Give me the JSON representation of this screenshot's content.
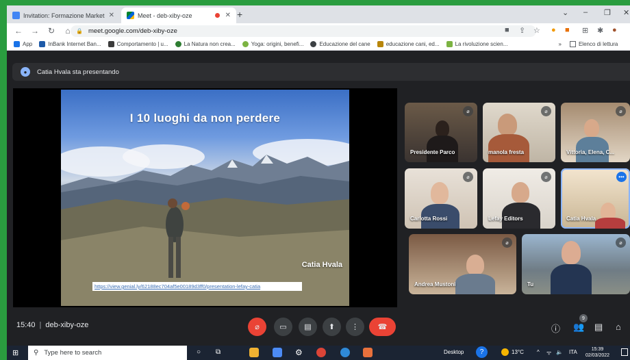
{
  "browser": {
    "tabs": [
      {
        "title": "Invitation: Formazione Marketing",
        "favicon": "calendar-icon",
        "active": false
      },
      {
        "title": "Meet - deb-xiby-oze",
        "favicon": "meet-icon",
        "active": true
      }
    ],
    "url": "meet.google.com/deb-xiby-oze",
    "bookmarks": [
      {
        "label": "App",
        "icon": "apps-grid-icon",
        "color": "#1a73e8"
      },
      {
        "label": "InBank Internet Ban...",
        "icon": "inbank-icon",
        "color": "#1e5aa8"
      },
      {
        "label": "Comportamento | u...",
        "icon": "page-icon",
        "color": "#3b3b3b"
      },
      {
        "label": "La Natura non crea...",
        "icon": "leaf-icon",
        "color": "#2e7d32"
      },
      {
        "label": "Yoga: origini, benefi...",
        "icon": "leaf-icon",
        "color": "#7cb342"
      },
      {
        "label": "Educazione del cane",
        "icon": "globe-icon",
        "color": "#3c4043"
      },
      {
        "label": "educazione cani, ed...",
        "icon": "dog-icon",
        "color": "#b8860b"
      },
      {
        "label": "La rivoluzione scien...",
        "icon": "page-icon",
        "color": "#7cb342"
      }
    ],
    "bookmarks_more": "»",
    "bookmarks_other": "Elenco di lettura"
  },
  "meet": {
    "presenting_label": "Catia Hvala sta presentando",
    "slide": {
      "title": "I 10 luoghi da non perdere",
      "author": "Catia  Hvala",
      "link": "https://view.genial.ly/62188ec704af5e00189d3ff0/presentation-lefay-catia"
    },
    "participants": [
      {
        "name": "Presidente Parco",
        "muted": true
      },
      {
        "name": "manola fresta",
        "muted": true
      },
      {
        "name": "Vittoria, Elena, C...",
        "muted": true
      },
      {
        "name": "Carlotta Rossi",
        "muted": true
      },
      {
        "name": "Lefay Editors",
        "muted": true
      },
      {
        "name": "Catia Hvala",
        "muted": false
      },
      {
        "name": "Andrea Mustoni",
        "muted": true
      },
      {
        "name": "Tu",
        "muted": true
      }
    ],
    "time": "15:40",
    "separator": "|",
    "meeting_code": "deb-xiby-oze",
    "participants_badge": "9",
    "accent_red": "#ea4335",
    "accent_blue": "#1a73e8"
  },
  "taskbar": {
    "search_placeholder": "Type here to search",
    "desktop_label": "Desktop",
    "weather": "13°C",
    "language": "ITA",
    "clock_time": "15:39",
    "clock_date": "02/03/2022"
  }
}
